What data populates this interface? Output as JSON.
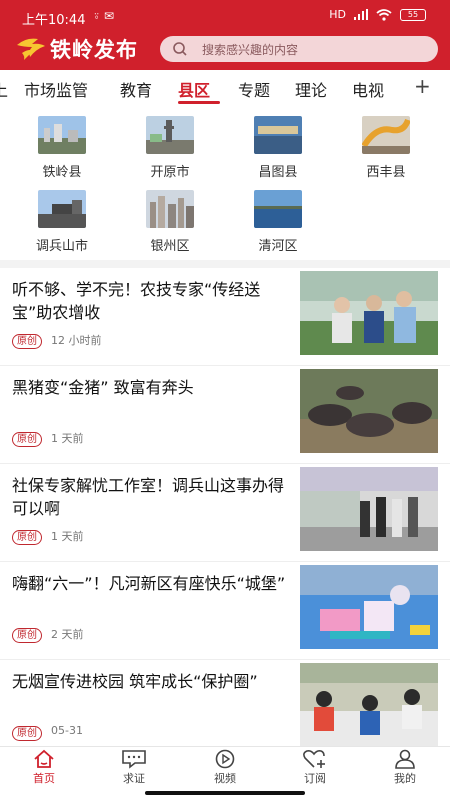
{
  "status_bar": {
    "time": "上午10:44",
    "status_icons": "⍤ ✉",
    "signal": "HD",
    "battery": "55"
  },
  "header": {
    "logo_text": "铁岭发布",
    "search_placeholder": "搜索感兴趣的内容"
  },
  "tabs": [
    {
      "label": "市场监管"
    },
    {
      "label": "教育"
    },
    {
      "label": "县区"
    },
    {
      "label": "专题"
    },
    {
      "label": "理论"
    },
    {
      "label": "电视"
    }
  ],
  "add_tab_icon": "plus-icon",
  "counties": [
    {
      "name": "铁岭县"
    },
    {
      "name": "开原市"
    },
    {
      "name": "昌图县"
    },
    {
      "name": "西丰县"
    },
    {
      "name": "调兵山市"
    },
    {
      "name": "银州区"
    },
    {
      "name": "清河区"
    }
  ],
  "news": [
    {
      "title": "听不够、学不完！农技专家“传经送宝”助农增收",
      "tag": "原创",
      "time": "12 小时前"
    },
    {
      "title": "黑猪变“金猪” 致富有奔头",
      "tag": "原创",
      "time": "1 天前"
    },
    {
      "title": "社保专家解忧工作室！调兵山这事办得可以啊",
      "tag": "原创",
      "time": "1 天前"
    },
    {
      "title": "嗨翻“六一”！凡河新区有座快乐“城堡”",
      "tag": "原创",
      "time": "2 天前"
    },
    {
      "title": "无烟宣传进校园 筑牢成长“保护圈”",
      "tag": "原创",
      "time": "05-31"
    }
  ],
  "bottom_nav": [
    {
      "label": "首页",
      "icon": "home-icon"
    },
    {
      "label": "求证",
      "icon": "chat-icon"
    },
    {
      "label": "视频",
      "icon": "play-icon"
    },
    {
      "label": "订阅",
      "icon": "heart-plus-icon"
    },
    {
      "label": "我的",
      "icon": "user-icon"
    }
  ],
  "colors": {
    "brand": "#d0202c",
    "search_bg": "#f3d6d8",
    "tag": "#c0282f"
  }
}
